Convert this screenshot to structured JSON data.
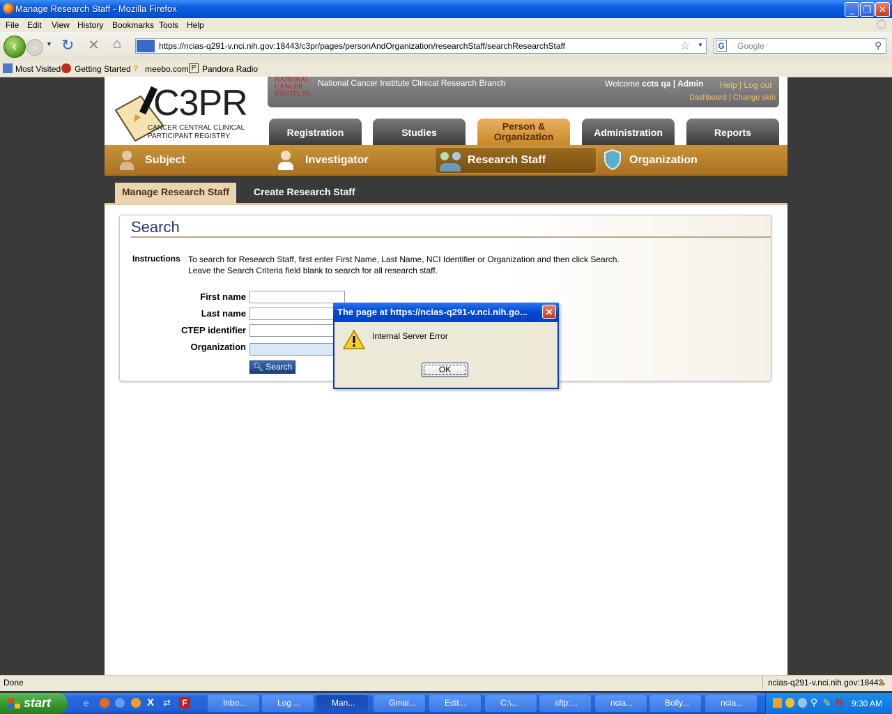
{
  "window": {
    "title": "Manage Research Staff - Mozilla Firefox"
  },
  "menu": [
    "File",
    "Edit",
    "View",
    "History",
    "Bookmarks",
    "Tools",
    "Help"
  ],
  "address": {
    "url": "https://ncias-q291-v.nci.nih.gov:18443/c3pr/pages/personAndOrganization/researchStaff/searchResearchStaff"
  },
  "websearch": {
    "placeholder": "Google"
  },
  "bookmarks": [
    "Most Visited",
    "Getting Started",
    "meebo.com",
    "Pandora Radio"
  ],
  "header": {
    "org_logo": "NATIONAL CANCER INSTITUTE",
    "branch": "National Cancer Institute Clinical Research Branch",
    "welcome_prefix": "Welcome",
    "welcome_user": "ccts qa | Admin",
    "help": "Help",
    "separator": "|",
    "logout": "Log out",
    "dashboard": "Dashboard",
    "change_skin": "| Change skin",
    "app_title": "C3PR",
    "app_sub1": "CANCER CENTRAL CLINICAL",
    "app_sub2": "PARTICIPANT REGISTRY"
  },
  "main_tabs": [
    "Registration",
    "Studies",
    "Person & Organization",
    "Administration",
    "Reports"
  ],
  "sub_nav": [
    "Subject",
    "Investigator",
    "Research Staff",
    "Organization"
  ],
  "page_tabs": [
    "Manage Research Staff",
    "Create Research Staff"
  ],
  "search": {
    "title": "Search",
    "instructions_label": "Instructions",
    "instructions_line1": "To search for Research Staff, first enter First Name, Last Name, NCI Identifier or Organization and then click Search.",
    "instructions_line2": "Leave the Search Criteria field blank to search for all research staff.",
    "fields": [
      "First name",
      "Last name",
      "CTEP identifier",
      "Organization"
    ],
    "button": "Search"
  },
  "dialog": {
    "title": "The page at https://ncias-q291-v.nci.nih.go...",
    "message": "Internal Server Error",
    "ok": "OK"
  },
  "status": {
    "left": "Done",
    "right": "ncias-q291-v.nci.nih.gov:18443"
  },
  "taskbar": {
    "start": "start",
    "tasks": [
      "Inbo...",
      "Log ...",
      "Man...",
      "Gmai...",
      "Edit...",
      "C:\\...",
      "sftp:...",
      "ncia...",
      "Bolly...",
      "ncia..."
    ],
    "clock": "9:30 AM"
  }
}
